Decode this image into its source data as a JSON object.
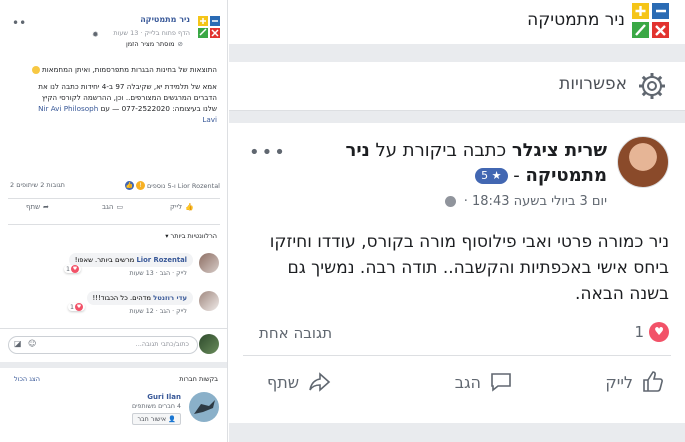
{
  "left": {
    "close": "••",
    "page_name": "ניר מתמטיקה",
    "subtitle": "הדף פתוח בלייק · 13 שעות",
    "hidden_note": "מוסתר מציר הזמן",
    "body_line1": "התוצאות של בחינות הבגרות מתפרסמות, ואיתן המחמאות",
    "body_line2": "אמא של תלמידת יא, שקיבלה 97 ב-4 יחידות כתבה לנו את",
    "body_line3": "הדברים המרגשים המצורפים.. וכן, ההרשמה לקורסי הקיץ",
    "body_line4": "שלנו בעיצומה: 077-2522020 — עם",
    "body_link": "Nir Avi Philosoph",
    "body_link2": "Lavi",
    "stats_left": "2 תגובות  2 שיתופים",
    "stats_right": "Lior Rozental ו-5 נוספים",
    "action_share": "שתף",
    "action_comment": "הגב",
    "action_like": "לייק",
    "relevant": "הרלוונטיות ביותר ▾",
    "comments": [
      {
        "name": "Lior Rozental",
        "text": "מרשים ביותר. שאפו!",
        "meta": "לייק · הגב · 13 שעות",
        "react_count": "1"
      },
      {
        "name": "עדי רוזנטל",
        "text": "מדהים. כל הכבוד!!!",
        "meta": "לייק · הגב · 12 שעות",
        "react_count": "1"
      }
    ],
    "write_placeholder": "כתוב/כתבי תגובה...",
    "friends_title": "בקשות חברות",
    "friends_seeall": "הצג הכול",
    "friend_name": "Guri Ilan",
    "friend_mutual": "4 חברים משותפים",
    "friend_btn": "אישור חבר"
  },
  "right": {
    "page_name": "ניר מתמטיקה",
    "options": "אפשרויות",
    "author": "שרית ציגלר",
    "wrote": "כתבה ביקורת על",
    "page": "ניר מתמטיקה",
    "dash": "-",
    "rating": "5 ★",
    "more": "•••",
    "time": "יום 3 ביולי בשעה 18:43 ·",
    "body": "ניר כמורה פרטי ואבי פילוסוף מורה בקורס, עודדו וחיזקו  ביחס אישי באכפתיות והקשבה.. תודה רבה. נמשיך גם בשנה הבאה.",
    "like_count": "1",
    "responses": "תגובה אחת",
    "action_like": "לייק",
    "action_comment": "הגב",
    "action_share": "שתף"
  },
  "colors": {
    "fb_blue": "#385898",
    "heart": "#f25268",
    "logo_yellow": "#f5c518",
    "logo_blue": "#2a6bb4",
    "logo_green": "#3aa845",
    "logo_red": "#e2332f"
  },
  "icons": [
    "close-icon",
    "gear-icon",
    "like-icon",
    "comment-icon",
    "share-icon",
    "heart-icon",
    "globe-icon",
    "more-icon",
    "calculator-logo-icon"
  ]
}
